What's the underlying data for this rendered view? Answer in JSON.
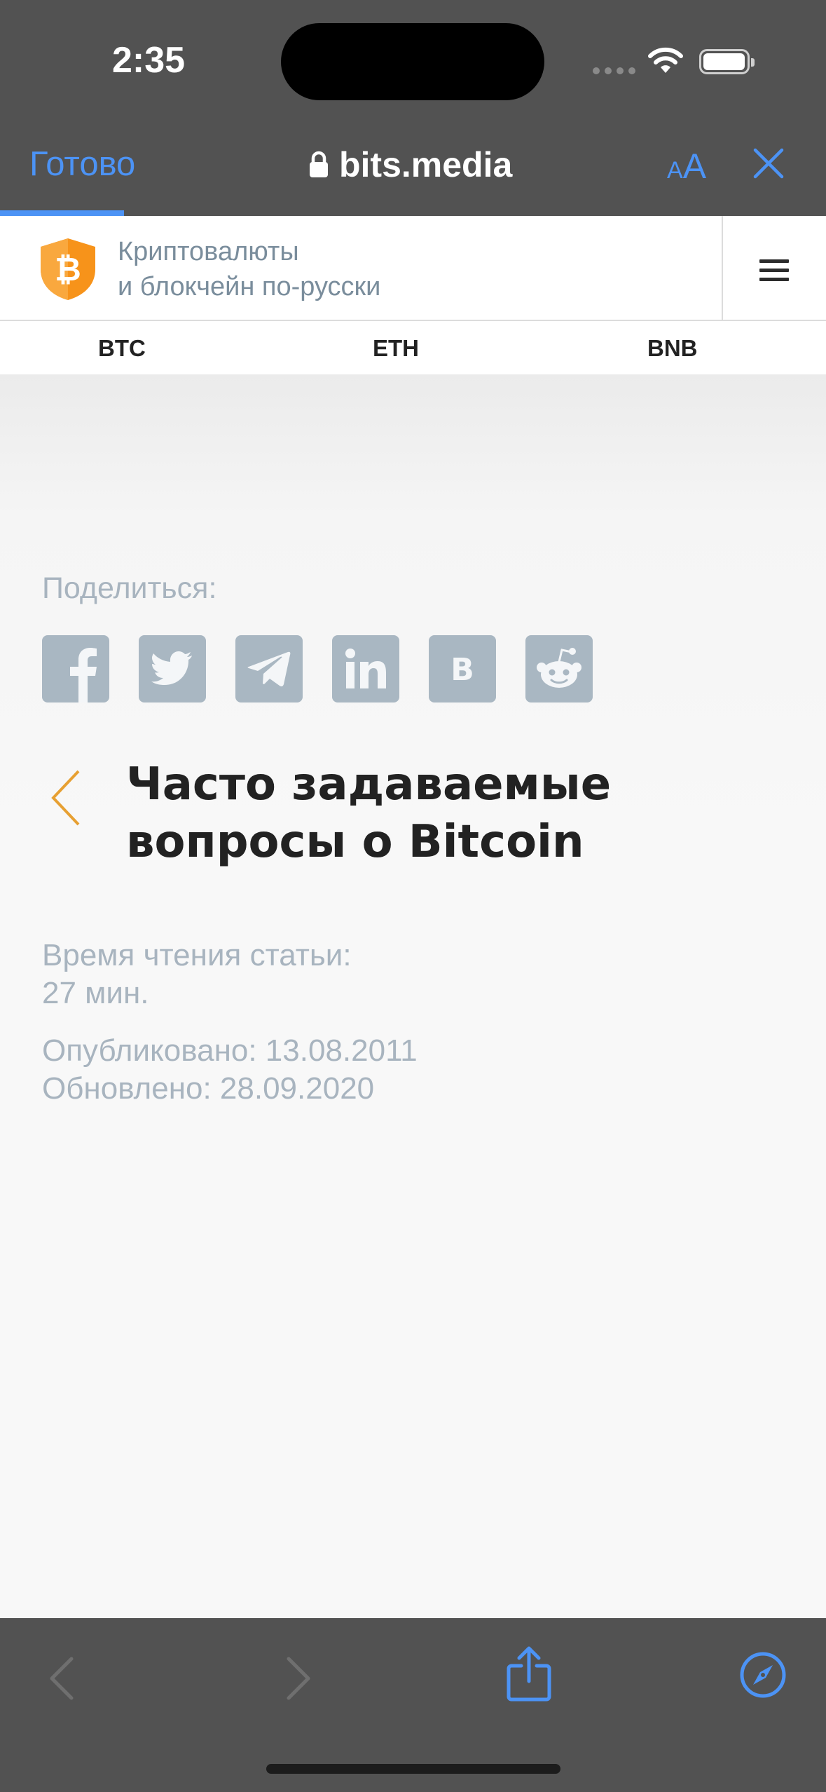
{
  "status_bar": {
    "time": "2:35"
  },
  "browser": {
    "done_label": "Готово",
    "url": "bits.media",
    "text_size_small": "A",
    "text_size_big": "A",
    "progress_fraction": 0.15
  },
  "site": {
    "tagline_line1": "Криптовалюты",
    "tagline_line2": "и блокчейн по-русски",
    "ticker": [
      "BTC",
      "ETH",
      "BNB"
    ]
  },
  "share": {
    "label": "Поделиться:",
    "buttons": [
      "facebook",
      "twitter",
      "telegram",
      "linkedin",
      "vk",
      "reddit"
    ],
    "vk_letter": "B"
  },
  "article": {
    "title_line1": "Часто задаваемые",
    "title_line2": "вопросы о Bitcoin",
    "reading_time_label": "Время чтения статьи:",
    "reading_time_value": "27 мин.",
    "published": "Опубликовано: 13.08.2011",
    "updated": "Обновлено: 28.09.2020"
  },
  "colors": {
    "accent": "#4c93f5",
    "chrome_bg": "#525252",
    "bitcoin_orange": "#f7931a",
    "muted_text": "#a8b4bf",
    "share_icon_bg": "#a9b7c2"
  },
  "toolbar": {
    "icons": [
      "back-icon",
      "forward-icon",
      "share-icon",
      "compass-icon"
    ]
  }
}
